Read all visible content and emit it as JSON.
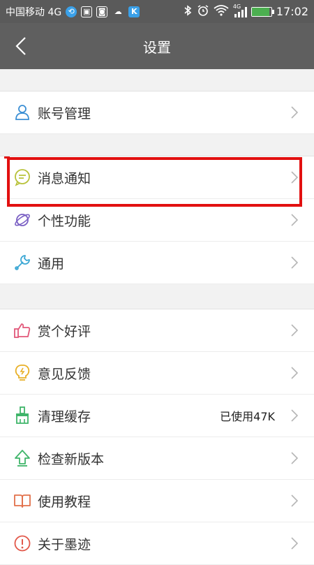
{
  "statusbar": {
    "carrier": "中国移动 4G",
    "time": "17:02",
    "network": "4G",
    "battery_percent": 90,
    "icons": [
      "sync-icon",
      "image-icon",
      "camera-icon",
      "cloud-icon",
      "k-app-icon",
      "bluetooth-icon",
      "alarm-icon",
      "wifi-icon",
      "signal-icon",
      "battery-icon"
    ]
  },
  "header": {
    "title": "设置",
    "back_icon": "back-arrow-icon"
  },
  "groups": [
    {
      "items": [
        {
          "label": "账号管理",
          "icon": "user-icon",
          "color": "#3b8fd4"
        }
      ]
    },
    {
      "items": [
        {
          "label": "消息通知",
          "icon": "message-icon",
          "color": "#b8c23a"
        },
        {
          "label": "个性功能",
          "icon": "planet-icon",
          "color": "#7a5fc4"
        },
        {
          "label": "通用",
          "icon": "wrench-icon",
          "color": "#3ba7d4"
        }
      ]
    },
    {
      "items": [
        {
          "label": "赏个好评",
          "icon": "thumbs-up-icon",
          "color": "#e2587a"
        },
        {
          "label": "意见反馈",
          "icon": "lightbulb-icon",
          "color": "#e8b028"
        },
        {
          "label": "清理缓存",
          "icon": "broom-icon",
          "color": "#3fb56a",
          "value": "已使用47K"
        },
        {
          "label": "检查新版本",
          "icon": "upload-arrow-icon",
          "color": "#3fb56a"
        },
        {
          "label": "使用教程",
          "icon": "book-icon",
          "color": "#e2704a"
        },
        {
          "label": "关于墨迹",
          "icon": "info-circle-icon",
          "color": "#e2584a"
        }
      ]
    }
  ],
  "colors": {
    "statusbar_bg": "#5a5a5a",
    "titlebar_bg": "#5f5f5f",
    "highlight": "#e21010",
    "chevron": "#b5b5b5"
  }
}
